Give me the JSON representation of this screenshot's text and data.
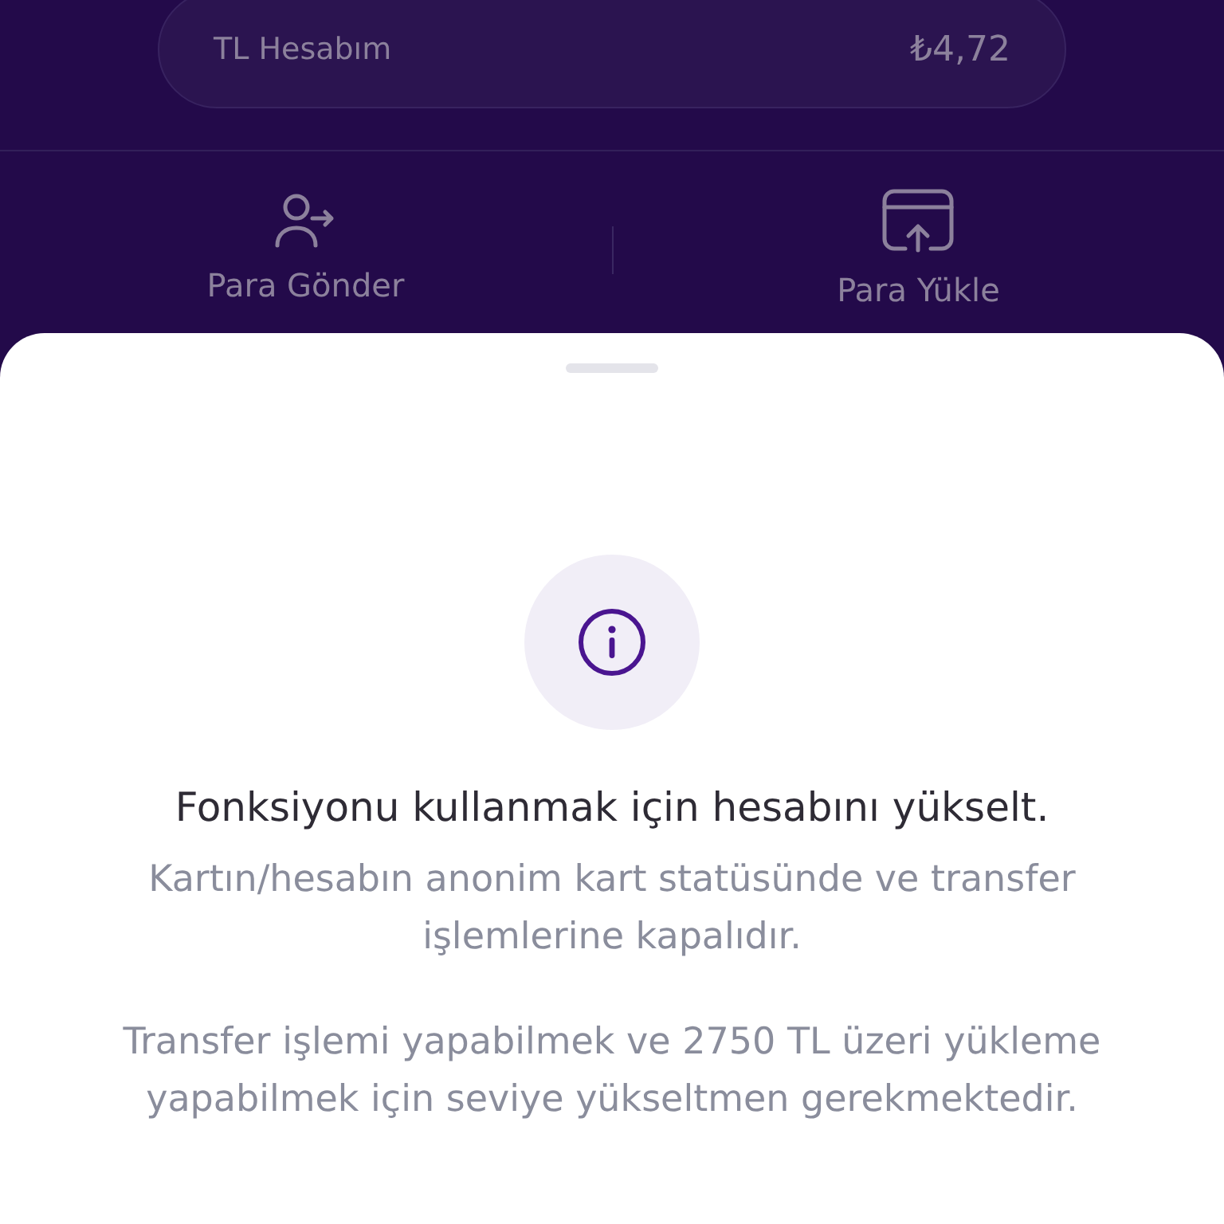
{
  "account": {
    "label": "TL Hesabım",
    "balance": "₺4,72"
  },
  "actions": [
    {
      "kind": "send",
      "label": "Para Gönder"
    },
    {
      "kind": "load",
      "label": "Para Yükle"
    }
  ],
  "sheet": {
    "title": "Fonksiyonu kullanmak için hesabını yükselt.",
    "paragraphs": [
      "Kartın/hesabın anonim kart statüsünde ve transfer işlemlerine kapalıdır.",
      "Transfer işlemi yapabilmek ve 2750 TL üzeri yükleme yapabilmek için seviye yükseltmen gerekmektedir."
    ]
  }
}
